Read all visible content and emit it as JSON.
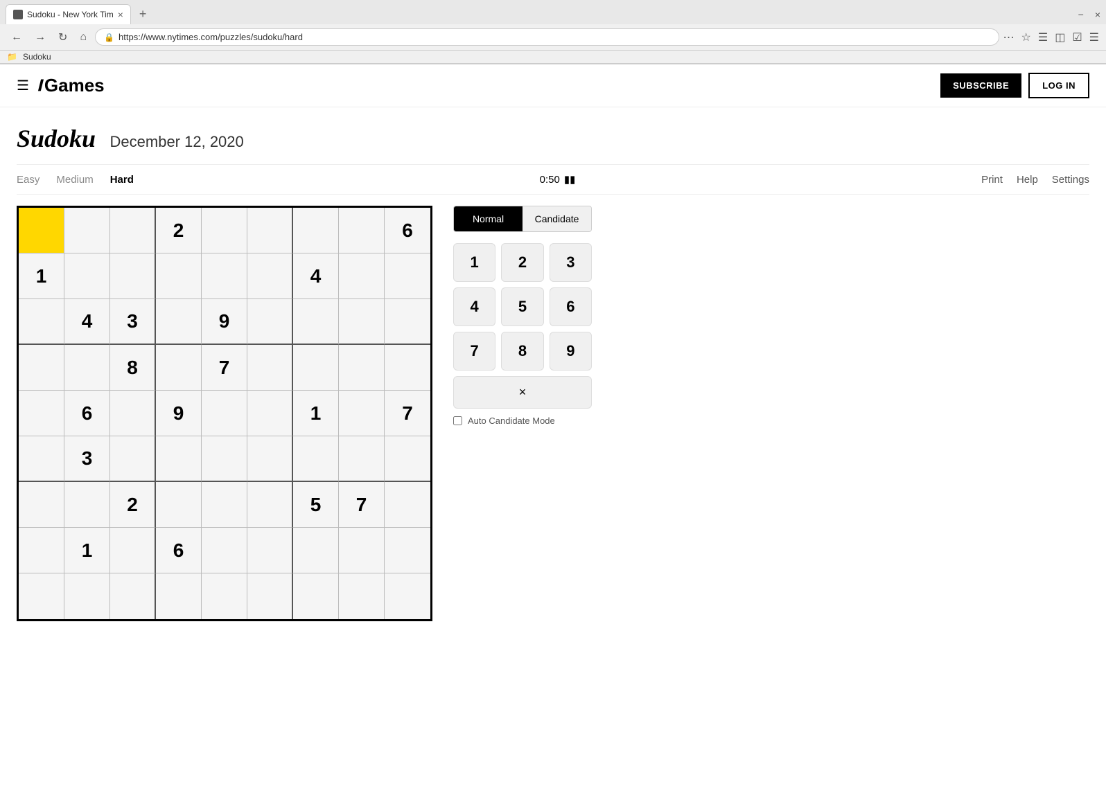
{
  "browser": {
    "tab_title": "Sudoku - New York Tim",
    "url": "https://www.nytimes.com/puzzles/sudoku/hard",
    "bookmark": "Sudoku",
    "window_min": "−",
    "window_close": "×",
    "new_tab": "+"
  },
  "header": {
    "logo_icon": "T",
    "logo_text": "Games",
    "subscribe_label": "SUBSCRIBE",
    "login_label": "LOG IN"
  },
  "puzzle": {
    "title": "Sudoku",
    "date": "December 12, 2020",
    "difficulty_links": [
      "Easy",
      "Medium",
      "Hard"
    ],
    "active_difficulty": "Hard",
    "timer": "0:50",
    "nav_actions": [
      "Print",
      "Help",
      "Settings"
    ]
  },
  "mode_buttons": {
    "normal": "Normal",
    "candidate": "Candidate"
  },
  "numpad": [
    "1",
    "2",
    "3",
    "4",
    "5",
    "6",
    "7",
    "8",
    "9"
  ],
  "erase_label": "×",
  "auto_candidate_label": "Auto Candidate Mode",
  "grid": {
    "cells": [
      {
        "row": 0,
        "col": 0,
        "value": "",
        "selected": true
      },
      {
        "row": 0,
        "col": 1,
        "value": "",
        "selected": false
      },
      {
        "row": 0,
        "col": 2,
        "value": "",
        "selected": false
      },
      {
        "row": 0,
        "col": 3,
        "value": "2",
        "selected": false
      },
      {
        "row": 0,
        "col": 4,
        "value": "",
        "selected": false
      },
      {
        "row": 0,
        "col": 5,
        "value": "",
        "selected": false
      },
      {
        "row": 0,
        "col": 6,
        "value": "",
        "selected": false
      },
      {
        "row": 0,
        "col": 7,
        "value": "",
        "selected": false
      },
      {
        "row": 0,
        "col": 8,
        "value": "6",
        "selected": false
      },
      {
        "row": 1,
        "col": 0,
        "value": "1",
        "selected": false
      },
      {
        "row": 1,
        "col": 1,
        "value": "",
        "selected": false
      },
      {
        "row": 1,
        "col": 2,
        "value": "",
        "selected": false
      },
      {
        "row": 1,
        "col": 3,
        "value": "",
        "selected": false
      },
      {
        "row": 1,
        "col": 4,
        "value": "",
        "selected": false
      },
      {
        "row": 1,
        "col": 5,
        "value": "",
        "selected": false
      },
      {
        "row": 1,
        "col": 6,
        "value": "4",
        "selected": false
      },
      {
        "row": 1,
        "col": 7,
        "value": "",
        "selected": false
      },
      {
        "row": 1,
        "col": 8,
        "value": "",
        "selected": false
      },
      {
        "row": 2,
        "col": 0,
        "value": "",
        "selected": false
      },
      {
        "row": 2,
        "col": 1,
        "value": "4",
        "selected": false
      },
      {
        "row": 2,
        "col": 2,
        "value": "3",
        "selected": false
      },
      {
        "row": 2,
        "col": 3,
        "value": "",
        "selected": false
      },
      {
        "row": 2,
        "col": 4,
        "value": "9",
        "selected": false
      },
      {
        "row": 2,
        "col": 5,
        "value": "",
        "selected": false
      },
      {
        "row": 2,
        "col": 6,
        "value": "",
        "selected": false
      },
      {
        "row": 2,
        "col": 7,
        "value": "",
        "selected": false
      },
      {
        "row": 2,
        "col": 8,
        "value": "",
        "selected": false
      },
      {
        "row": 3,
        "col": 0,
        "value": "",
        "selected": false
      },
      {
        "row": 3,
        "col": 1,
        "value": "",
        "selected": false
      },
      {
        "row": 3,
        "col": 2,
        "value": "8",
        "selected": false
      },
      {
        "row": 3,
        "col": 3,
        "value": "",
        "selected": false
      },
      {
        "row": 3,
        "col": 4,
        "value": "7",
        "selected": false
      },
      {
        "row": 3,
        "col": 5,
        "value": "",
        "selected": false
      },
      {
        "row": 3,
        "col": 6,
        "value": "",
        "selected": false
      },
      {
        "row": 3,
        "col": 7,
        "value": "",
        "selected": false
      },
      {
        "row": 3,
        "col": 8,
        "value": "",
        "selected": false
      },
      {
        "row": 4,
        "col": 0,
        "value": "",
        "selected": false
      },
      {
        "row": 4,
        "col": 1,
        "value": "6",
        "selected": false
      },
      {
        "row": 4,
        "col": 2,
        "value": "",
        "selected": false
      },
      {
        "row": 4,
        "col": 3,
        "value": "9",
        "selected": false
      },
      {
        "row": 4,
        "col": 4,
        "value": "",
        "selected": false
      },
      {
        "row": 4,
        "col": 5,
        "value": "",
        "selected": false
      },
      {
        "row": 4,
        "col": 6,
        "value": "1",
        "selected": false
      },
      {
        "row": 4,
        "col": 7,
        "value": "",
        "selected": false
      },
      {
        "row": 4,
        "col": 8,
        "value": "7",
        "selected": false
      },
      {
        "row": 5,
        "col": 0,
        "value": "",
        "selected": false
      },
      {
        "row": 5,
        "col": 1,
        "value": "3",
        "selected": false
      },
      {
        "row": 5,
        "col": 2,
        "value": "",
        "selected": false
      },
      {
        "row": 5,
        "col": 3,
        "value": "",
        "selected": false
      },
      {
        "row": 5,
        "col": 4,
        "value": "",
        "selected": false
      },
      {
        "row": 5,
        "col": 5,
        "value": "",
        "selected": false
      },
      {
        "row": 5,
        "col": 6,
        "value": "",
        "selected": false
      },
      {
        "row": 5,
        "col": 7,
        "value": "",
        "selected": false
      },
      {
        "row": 5,
        "col": 8,
        "value": "",
        "selected": false
      },
      {
        "row": 6,
        "col": 0,
        "value": "",
        "selected": false
      },
      {
        "row": 6,
        "col": 1,
        "value": "",
        "selected": false
      },
      {
        "row": 6,
        "col": 2,
        "value": "2",
        "selected": false
      },
      {
        "row": 6,
        "col": 3,
        "value": "",
        "selected": false
      },
      {
        "row": 6,
        "col": 4,
        "value": "",
        "selected": false
      },
      {
        "row": 6,
        "col": 5,
        "value": "",
        "selected": false
      },
      {
        "row": 6,
        "col": 6,
        "value": "5",
        "selected": false
      },
      {
        "row": 6,
        "col": 7,
        "value": "7",
        "selected": false
      },
      {
        "row": 6,
        "col": 8,
        "value": "",
        "selected": false
      },
      {
        "row": 7,
        "col": 0,
        "value": "",
        "selected": false
      },
      {
        "row": 7,
        "col": 1,
        "value": "1",
        "selected": false
      },
      {
        "row": 7,
        "col": 2,
        "value": "",
        "selected": false
      },
      {
        "row": 7,
        "col": 3,
        "value": "6",
        "selected": false
      },
      {
        "row": 7,
        "col": 4,
        "value": "",
        "selected": false
      },
      {
        "row": 7,
        "col": 5,
        "value": "",
        "selected": false
      },
      {
        "row": 7,
        "col": 6,
        "value": "",
        "selected": false
      },
      {
        "row": 7,
        "col": 7,
        "value": "",
        "selected": false
      },
      {
        "row": 7,
        "col": 8,
        "value": "",
        "selected": false
      },
      {
        "row": 8,
        "col": 0,
        "value": "",
        "selected": false
      },
      {
        "row": 8,
        "col": 1,
        "value": "",
        "selected": false
      },
      {
        "row": 8,
        "col": 2,
        "value": "",
        "selected": false
      },
      {
        "row": 8,
        "col": 3,
        "value": "",
        "selected": false
      },
      {
        "row": 8,
        "col": 4,
        "value": "",
        "selected": false
      },
      {
        "row": 8,
        "col": 5,
        "value": "",
        "selected": false
      },
      {
        "row": 8,
        "col": 6,
        "value": "",
        "selected": false
      },
      {
        "row": 8,
        "col": 7,
        "value": "",
        "selected": false
      },
      {
        "row": 8,
        "col": 8,
        "value": "",
        "selected": false
      }
    ]
  }
}
